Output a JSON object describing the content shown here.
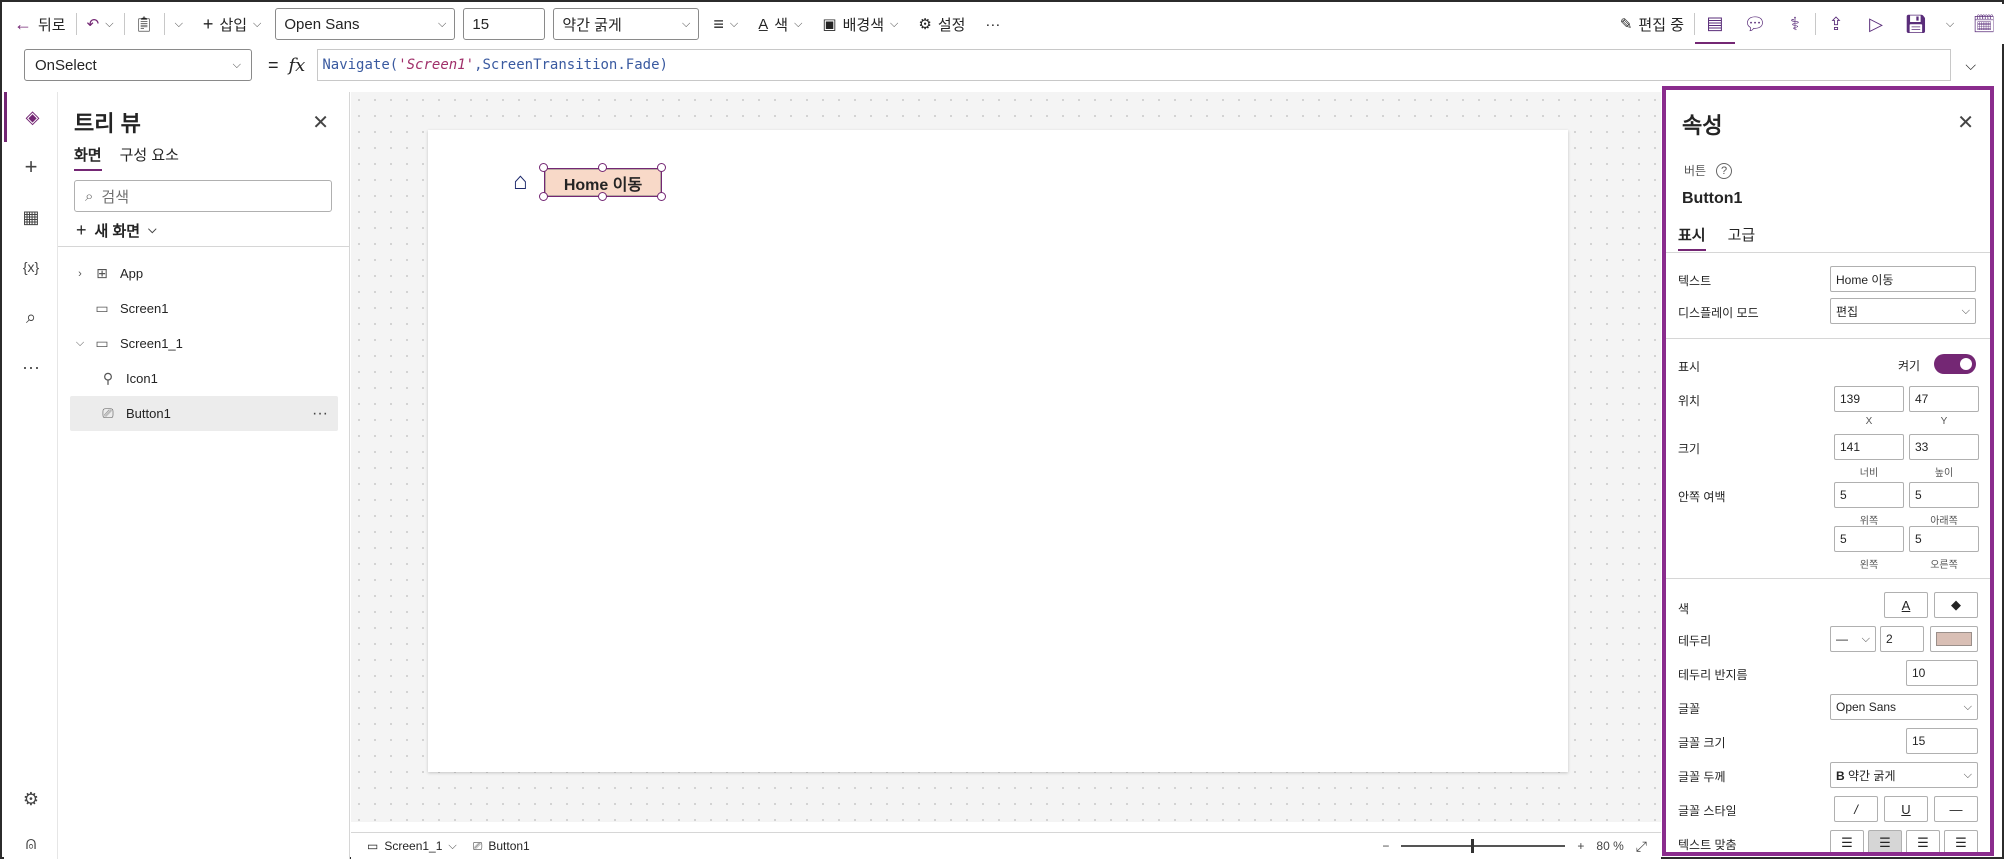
{
  "toolbar": {
    "back_label": "뒤로",
    "insert_label": "삽입",
    "font_value": "Open Sans",
    "font_size_value": "15",
    "weight_value": "약간 굵게",
    "color_label": "색",
    "fill_label": "배경색",
    "settings_label": "설정",
    "more_label": "···",
    "editing_label": "편집 중"
  },
  "formula": {
    "property": "OnSelect",
    "equals": "=",
    "fx": "fx",
    "fn_name": "Navigate(",
    "arg_string": "'Screen1'",
    "rest": ",ScreenTransition.Fade)"
  },
  "tree": {
    "title": "트리 뷰",
    "tabs": [
      "화면",
      "구성 요소"
    ],
    "search_placeholder": "검색",
    "new_screen_label": "새 화면",
    "items": [
      {
        "label": "App"
      },
      {
        "label": "Screen1"
      },
      {
        "label": "Screen1_1"
      },
      {
        "label": "Icon1"
      },
      {
        "label": "Button1"
      }
    ],
    "more": "···"
  },
  "canvas": {
    "button_text": "Home 이동"
  },
  "bottombar": {
    "screen": "Screen1_1",
    "control": "Button1",
    "zoom_minus": "−",
    "zoom_plus": "+",
    "zoom_value": "80",
    "zoom_unit": "%",
    "zoom_level": 0.8
  },
  "properties": {
    "title": "속성",
    "control_type": "버튼",
    "help": "?",
    "control_name": "Button1",
    "tabs": [
      "표시",
      "고급"
    ],
    "text_label": "텍스트",
    "text_value": "Home 이동",
    "display_mode_label": "디스플레이 모드",
    "display_mode_value": "편집",
    "visible_label": "표시",
    "visible_state": "켜기",
    "position_label": "위치",
    "x_value": "139",
    "y_value": "47",
    "x_sub": "X",
    "y_sub": "Y",
    "size_label": "크기",
    "width_value": "141",
    "height_value": "33",
    "width_sub": "너비",
    "height_sub": "높이",
    "padding_label": "안쪽 여백",
    "pad_top": "5",
    "pad_bottom": "5",
    "pad_left": "5",
    "pad_right": "5",
    "pad_top_sub": "위쪽",
    "pad_bottom_sub": "아래쪽",
    "pad_left_sub": "왼쪽",
    "pad_right_sub": "오른쪽",
    "color_label": "색",
    "color_a": "A",
    "border_label": "테두리",
    "border_style": "—",
    "border_width": "2",
    "border_color": "#d9bfb5",
    "radius_label": "테두리 반지름",
    "radius_value": "10",
    "font_label": "글꼴",
    "font_value": "Open Sans",
    "font_size_label": "글꼴 크기",
    "font_size_value": "15",
    "font_weight_label": "글꼴 두께",
    "font_weight_b": "B",
    "font_weight_value": "약간 굵게",
    "font_style_label": "글꼴 스타일",
    "italic": "/",
    "underline": "U",
    "strike": "—",
    "align_label": "텍스트 맞춤"
  },
  "colors": {
    "accent": "#742774",
    "button_fill": "#f8d9c8",
    "panel_border": "#8a2c8d"
  }
}
